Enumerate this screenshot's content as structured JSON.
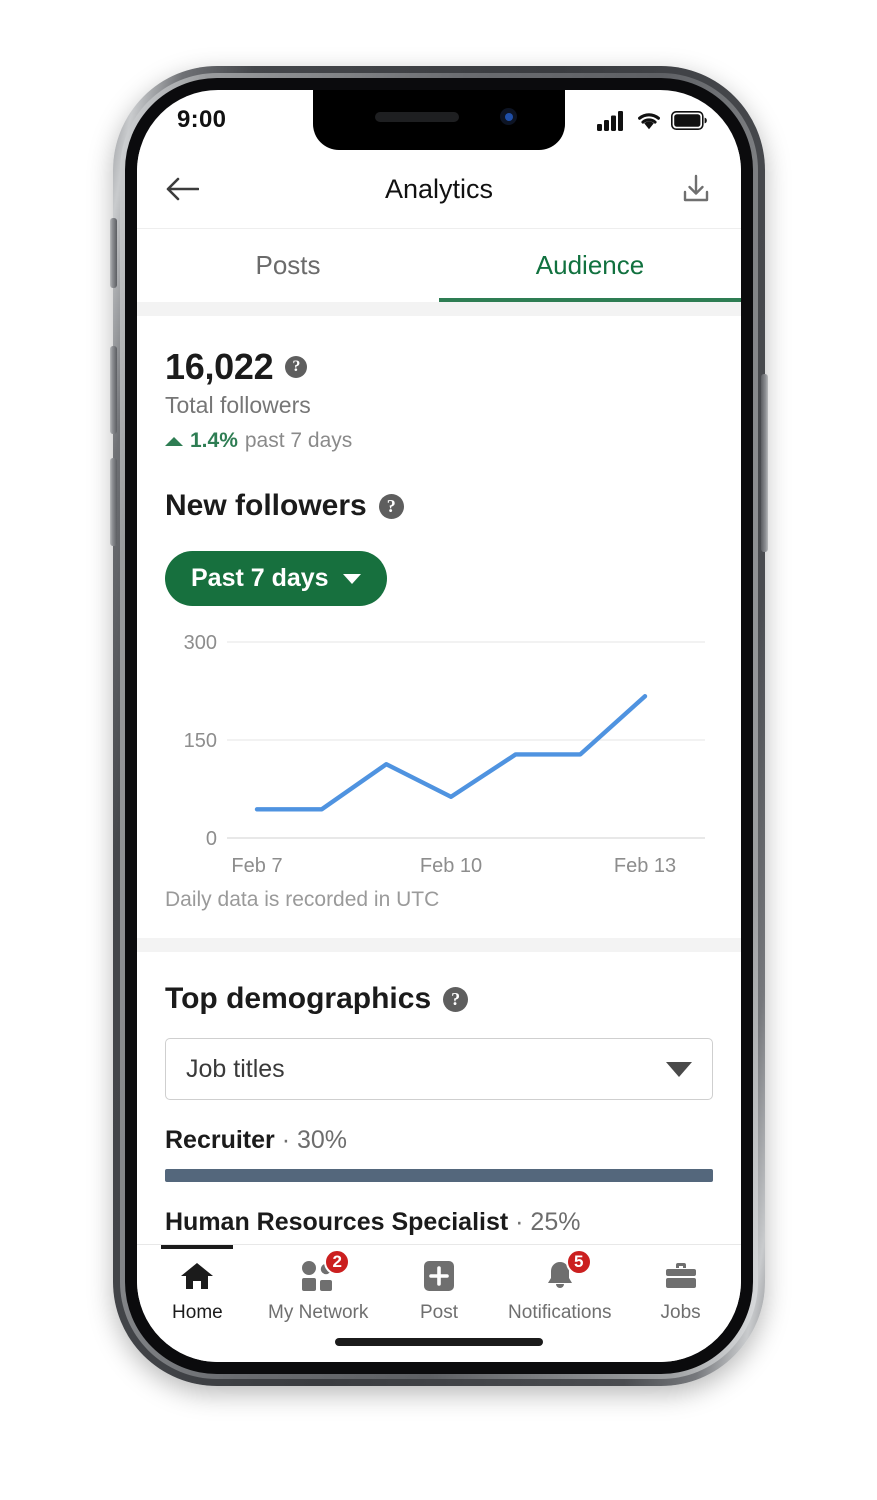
{
  "status_bar": {
    "time": "9:00",
    "icons": [
      "cellular-signal-icon",
      "wifi-icon",
      "battery-icon"
    ]
  },
  "navbar": {
    "back_icon": "back-arrow-icon",
    "title": "Analytics",
    "download_icon": "download-icon"
  },
  "tabs": [
    {
      "label": "Posts",
      "active": false
    },
    {
      "label": "Audience",
      "active": true
    }
  ],
  "followers": {
    "total": "16,022",
    "total_label": "Total followers",
    "delta_value": "1.4%",
    "delta_text": "past 7 days",
    "delta_direction": "up",
    "help_icon": "help-circle-icon"
  },
  "new_followers": {
    "heading": "New followers",
    "help_icon": "help-circle-icon",
    "range_button": "Past 7 days",
    "range_caret_icon": "chevron-down-icon",
    "footnote": "Daily data is recorded in UTC"
  },
  "chart_data": {
    "type": "line",
    "title": "New followers",
    "xlabel": "",
    "ylabel": "",
    "x": [
      "Feb 7",
      "Feb 8",
      "Feb 9",
      "Feb 10",
      "Feb 11",
      "Feb 12",
      "Feb 13"
    ],
    "tick_labels_shown": [
      "Feb 7",
      "Feb 10",
      "Feb 13"
    ],
    "values": [
      44,
      44,
      113,
      63,
      128,
      128,
      217
    ],
    "yticks": [
      0,
      150,
      300
    ],
    "ylim": [
      0,
      300
    ],
    "grid": true,
    "legend": false,
    "line_color": "#4f93e0",
    "gridline_color": "#ececec"
  },
  "demographics": {
    "heading": "Top demographics",
    "help_icon": "help-circle-icon",
    "select_value": "Job titles",
    "select_caret_icon": "chevron-down-icon",
    "bar_color": "#54677c",
    "items": [
      {
        "name": "Recruiter",
        "separator": "·",
        "percent": "30%",
        "fill": 100
      },
      {
        "name": "Human Resources Specialist",
        "separator": "·",
        "percent": "25%",
        "fill": 83
      }
    ]
  },
  "bottom_nav": [
    {
      "label": "Home",
      "icon": "home-icon",
      "badge": "",
      "active": true
    },
    {
      "label": "My Network",
      "icon": "people-icon",
      "badge": "2",
      "active": false
    },
    {
      "label": "Post",
      "icon": "plus-square-icon",
      "badge": "",
      "active": false
    },
    {
      "label": "Notifications",
      "icon": "bell-icon",
      "badge": "5",
      "active": false
    },
    {
      "label": "Jobs",
      "icon": "briefcase-icon",
      "badge": "",
      "active": false
    }
  ],
  "colors": {
    "brand_green": "#17703e",
    "tab_active_green": "#2e7d53",
    "chart_blue": "#4f93e0",
    "bar_slate": "#54677c",
    "badge_red": "#cb1f1f"
  }
}
